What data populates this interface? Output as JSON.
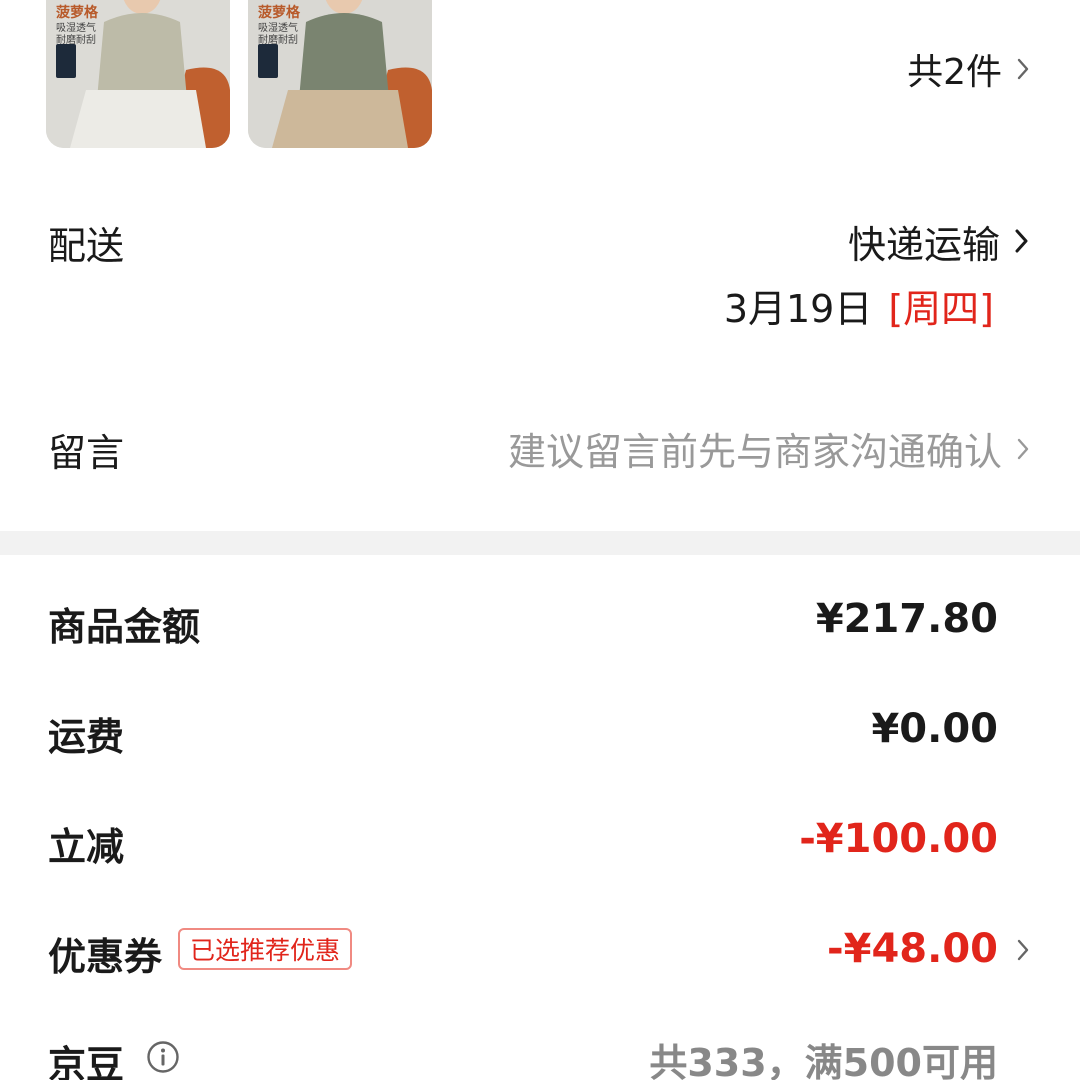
{
  "products": {
    "items": [
      {
        "brand": "菠萝格",
        "tag_line1": "吸湿透气",
        "tag_line2": "耐磨耐刮",
        "shirt_color": "#bdbba8"
      },
      {
        "brand": "菠萝格",
        "tag_line1": "吸湿透气",
        "tag_line2": "耐磨耐刮",
        "shirt_color": "#7a8470"
      }
    ],
    "count_label": "共2件"
  },
  "delivery": {
    "label": "配送",
    "method": "快递运输",
    "date": "3月19日",
    "weekday": "[周四]"
  },
  "note": {
    "label": "留言",
    "placeholder": "建议留言前先与商家沟通确认"
  },
  "summary": {
    "goods_amount": {
      "label": "商品金额",
      "value": "¥217.80"
    },
    "shipping": {
      "label": "运费",
      "value": "¥0.00"
    },
    "instant_discount": {
      "label": "立减",
      "value": "-¥100.00"
    },
    "coupon": {
      "label": "优惠券",
      "badge": "已选推荐优惠",
      "value": "-¥48.00"
    },
    "jd_beans": {
      "label": "京豆",
      "value": "共333，满500可用"
    }
  },
  "colors": {
    "accent_red": "#e1251b",
    "muted_gray": "#999999",
    "divider": "#f2f2f2"
  }
}
